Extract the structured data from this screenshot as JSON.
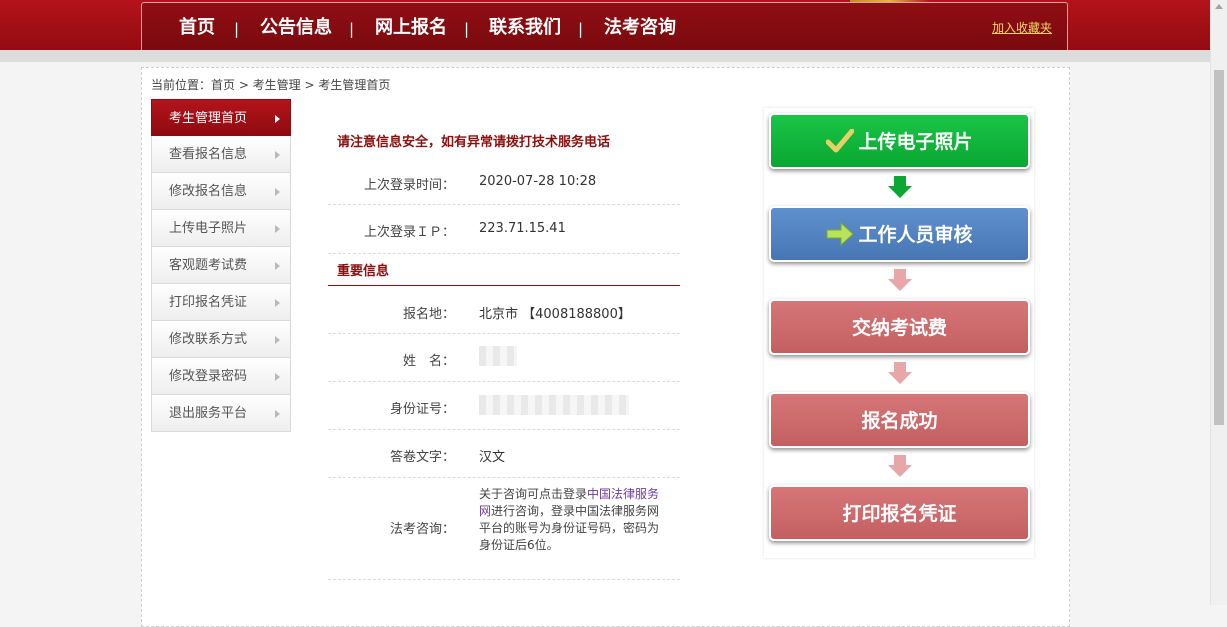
{
  "nav": {
    "items": [
      "首页",
      "公告信息",
      "网上报名",
      "联系我们",
      "法考咨询"
    ],
    "separator": "|",
    "favorite": "加入收藏夹"
  },
  "breadcrumb": "当前位置：首页 > 考生管理 > 考生管理首页",
  "sidebar": {
    "items": [
      {
        "label": "考生管理首页",
        "active": true
      },
      {
        "label": "查看报名信息"
      },
      {
        "label": "修改报名信息"
      },
      {
        "label": "上传电子照片"
      },
      {
        "label": "客观题考试费"
      },
      {
        "label": "打印报名凭证"
      },
      {
        "label": "修改联系方式"
      },
      {
        "label": "修改登录密码"
      },
      {
        "label": "退出服务平台"
      }
    ]
  },
  "notice": "请注意信息安全，如有异常请拨打技术服务电话",
  "login": {
    "time_label": "上次登录时间：",
    "time_value": "2020-07-28 10:28",
    "ip_label": "上次登录ＩＰ：",
    "ip_value": "223.71.15.41"
  },
  "important": {
    "title": "重要信息",
    "place_label": "报名地：",
    "place_value": "北京市 【4008188800】",
    "name_label": "姓　名：",
    "id_label": "身份证号：",
    "lang_label": "答卷文字：",
    "lang_value": "汉文",
    "consult_label": "法考咨询：",
    "consult_pre": "关于咨询可点击登录",
    "consult_link": "中国法律服务网",
    "consult_post": "进行咨询，登录中国法律服务网平台的账号为身份证号码，密码为身份证后6位。"
  },
  "flow": {
    "steps": [
      "上传电子照片",
      "工作人员审核",
      "交纳考试费",
      "报名成功",
      "打印报名凭证"
    ]
  },
  "colors": {
    "brand_red": "#8b0f0f",
    "step_done": "#0aa732",
    "step_current": "#4876b4",
    "step_pending": "#c35f61"
  }
}
